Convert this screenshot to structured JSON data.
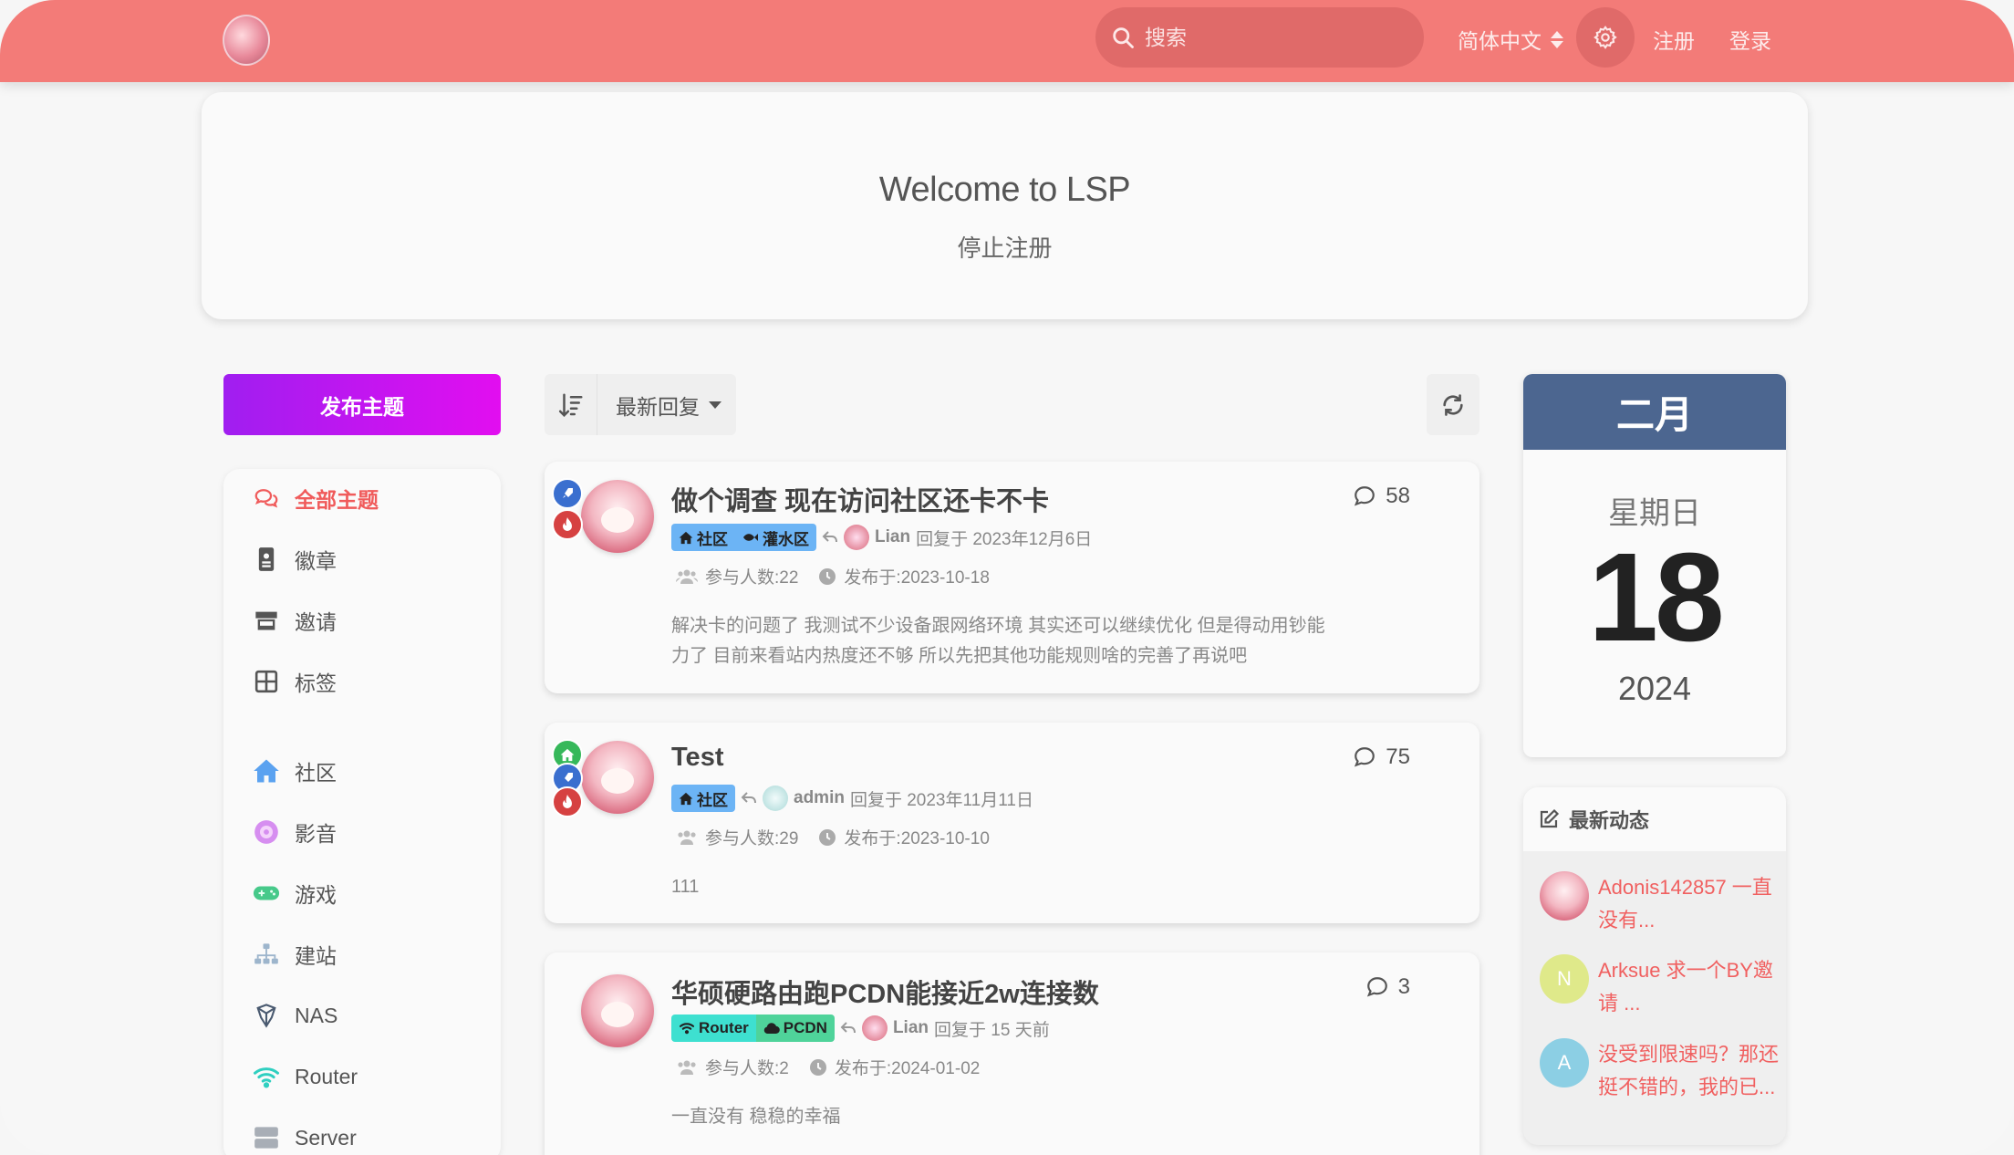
{
  "header": {
    "search_placeholder": "搜索",
    "language": "简体中文",
    "register": "注册",
    "login": "登录"
  },
  "hero": {
    "title": "Welcome to LSP",
    "subtitle": "停止注册"
  },
  "sidebar": {
    "post_button": "发布主题",
    "items": [
      {
        "label": "全部主题",
        "icon": "comments-icon"
      },
      {
        "label": "徽章",
        "icon": "badge-icon"
      },
      {
        "label": "邀请",
        "icon": "store-icon"
      },
      {
        "label": "标签",
        "icon": "grid-icon"
      },
      {
        "label": "社区",
        "icon": "home-icon"
      },
      {
        "label": "影音",
        "icon": "disc-icon"
      },
      {
        "label": "游戏",
        "icon": "gamepad-icon"
      },
      {
        "label": "建站",
        "icon": "sitemap-icon"
      },
      {
        "label": "NAS",
        "icon": "nas-icon"
      },
      {
        "label": "Router",
        "icon": "wifi-icon"
      },
      {
        "label": "Server",
        "icon": "server-icon"
      }
    ]
  },
  "toolbar": {
    "sort_label": "最新回复"
  },
  "posts": [
    {
      "title": "做个调查 现在访问社区还卡不卡",
      "replies": "58",
      "tags": [
        "社区",
        "灌水区"
      ],
      "last_user": "Lian",
      "last_reply": "回复于 2023年12月6日",
      "participants": "参与人数:22",
      "published": "发布于:2023-10-18",
      "excerpt": "解决卡的问题了 我测试不少设备跟网络环境 其实还可以继续优化 但是得动用钞能力了 目前来看站内热度还不够 所以先把其他功能规则啥的完善了再说吧"
    },
    {
      "title": "Test",
      "replies": "75",
      "tags": [
        "社区"
      ],
      "last_user": "admin",
      "last_reply": "回复于 2023年11月11日",
      "participants": "参与人数:29",
      "published": "发布于:2023-10-10",
      "excerpt": "111"
    },
    {
      "title": "华硕硬路由跑PCDN能接近2w连接数",
      "replies": "3",
      "tags": [
        "Router",
        "PCDN"
      ],
      "last_user": "Lian",
      "last_reply": "回复于 15 天前",
      "participants": "参与人数:2",
      "published": "发布于:2024-01-02",
      "excerpt": "一直没有 稳稳的幸福"
    }
  ],
  "calendar": {
    "month": "二月",
    "weekday": "星期日",
    "day": "18",
    "year": "2024"
  },
  "activity": {
    "title": "最新动态",
    "items": [
      {
        "avatar": "",
        "text": "Adonis142857 一直没有..."
      },
      {
        "avatar": "N",
        "text": "Arksue 求一个BY邀请 ..."
      },
      {
        "avatar": "A",
        "text": "没受到限速吗？那还挺不错的，我的已..."
      }
    ]
  },
  "colors": {
    "header": "#f37b78",
    "accent_red": "#f05b5b",
    "calendar_head": "#4c6690",
    "post_button_start": "#a01ef0",
    "post_button_end": "#e20ef0"
  }
}
